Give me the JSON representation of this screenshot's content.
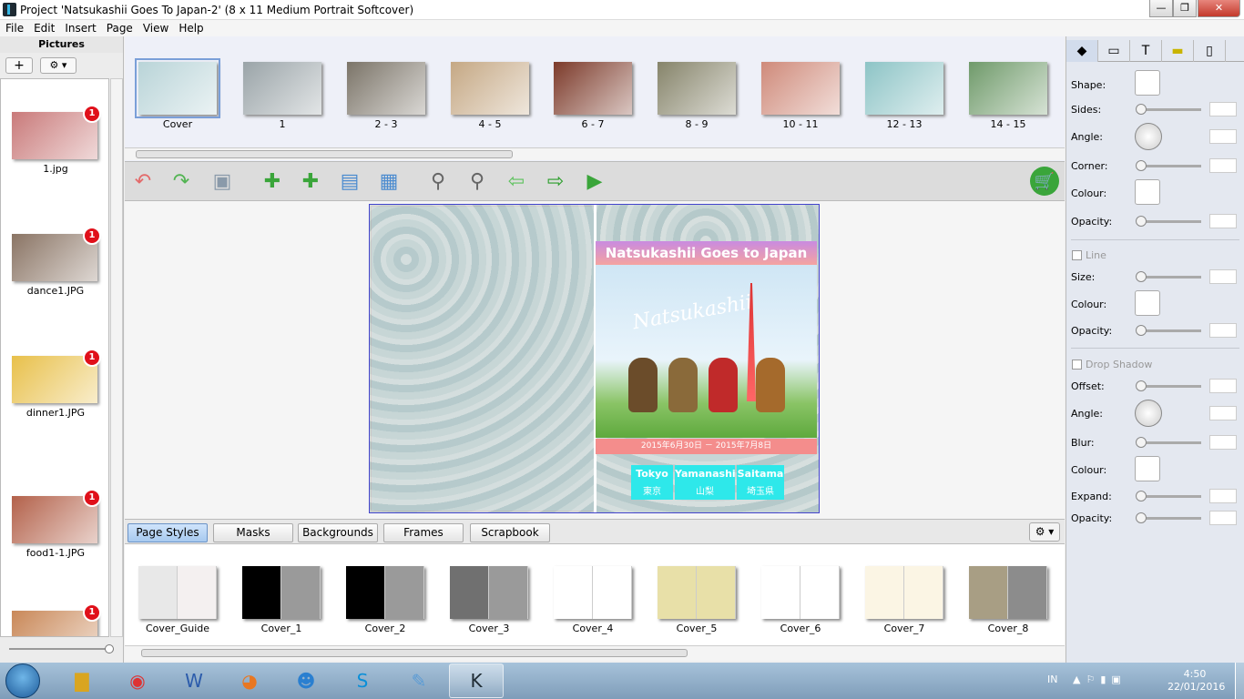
{
  "window": {
    "title": "Project 'Natsukashii Goes To Japan-2' (8 x 11 Medium Portrait Softcover)",
    "min": "—",
    "max": "❐",
    "close": "✕"
  },
  "menu": [
    "File",
    "Edit",
    "Insert",
    "Page",
    "View",
    "Help"
  ],
  "pictures_panel": {
    "title": "Pictures",
    "add_label": "+",
    "gear_label": "⚙ ▾",
    "items": [
      {
        "label": "1.jpg",
        "badge": "1",
        "color": "#c97a7a"
      },
      {
        "label": "dance1.JPG",
        "badge": "1",
        "color": "#8a7464"
      },
      {
        "label": "dinner1.JPG",
        "badge": "1",
        "color": "#e8c04a"
      },
      {
        "label": "food1-1.JPG",
        "badge": "1",
        "color": "#b3614a"
      },
      {
        "label": "",
        "badge": "1",
        "color": "#c98858"
      }
    ]
  },
  "pages": [
    {
      "label": "Cover",
      "color": "#b9d4d8",
      "selected": true
    },
    {
      "label": "1",
      "color": "#9aa4a8"
    },
    {
      "label": "2 - 3",
      "color": "#7b7468"
    },
    {
      "label": "4 - 5",
      "color": "#c5a884"
    },
    {
      "label": "6 - 7",
      "color": "#7c3a2a"
    },
    {
      "label": "8 - 9",
      "color": "#86846a"
    },
    {
      "label": "10 - 11",
      "color": "#cf8a7a"
    },
    {
      "label": "12 - 13",
      "color": "#8dc4c6"
    },
    {
      "label": "14 - 15",
      "color": "#6f9a6a"
    }
  ],
  "cover": {
    "title": "Natsukashii Goes to Japan",
    "watermark": "Natsukashii",
    "dates": "2015年6月30日 － 2015年7月8日",
    "cities": [
      {
        "en": "Tokyo",
        "jp": "東京"
      },
      {
        "en": "Yamanashi",
        "jp": "山梨"
      },
      {
        "en": "Saitama",
        "jp": "埼玉県"
      }
    ]
  },
  "tabs": [
    "Page Styles",
    "Masks",
    "Backgrounds",
    "Frames",
    "Scrapbook"
  ],
  "tab_gear": "⚙ ▾",
  "styles": [
    {
      "label": "Cover_Guide",
      "a": "#e8e8e8",
      "b": "#f4f0f0"
    },
    {
      "label": "Cover_1",
      "a": "#000000",
      "b": "#9a9a9a"
    },
    {
      "label": "Cover_2",
      "a": "#000000",
      "b": "#9a9a9a"
    },
    {
      "label": "Cover_3",
      "a": "#707070",
      "b": "#9a9a9a"
    },
    {
      "label": "Cover_4",
      "a": "#ffffff",
      "b": "#ffffff"
    },
    {
      "label": "Cover_5",
      "a": "#e8e0a8",
      "b": "#e8e0a8"
    },
    {
      "label": "Cover_6",
      "a": "#ffffff",
      "b": "#ffffff"
    },
    {
      "label": "Cover_7",
      "a": "#fbf5e4",
      "b": "#fbf5e4"
    },
    {
      "label": "Cover_8",
      "a": "#a89e84",
      "b": "#8c8c8c"
    }
  ],
  "props": {
    "shape": "Shape:",
    "sides": "Sides:",
    "angle": "Angle:",
    "corner": "Corner:",
    "colour": "Colour:",
    "opacity": "Opacity:",
    "line": "Line",
    "size": "Size:",
    "line_colour": "Colour:",
    "line_opacity": "Opacity:",
    "drop_shadow": "Drop Shadow",
    "offset": "Offset:",
    "ds_angle": "Angle:",
    "blur": "Blur:",
    "ds_colour": "Colour:",
    "expand": "Expand:",
    "ds_opacity": "Opacity:"
  },
  "taskbar": {
    "lang": "IN",
    "time": "4:50",
    "date": "22/01/2016"
  }
}
